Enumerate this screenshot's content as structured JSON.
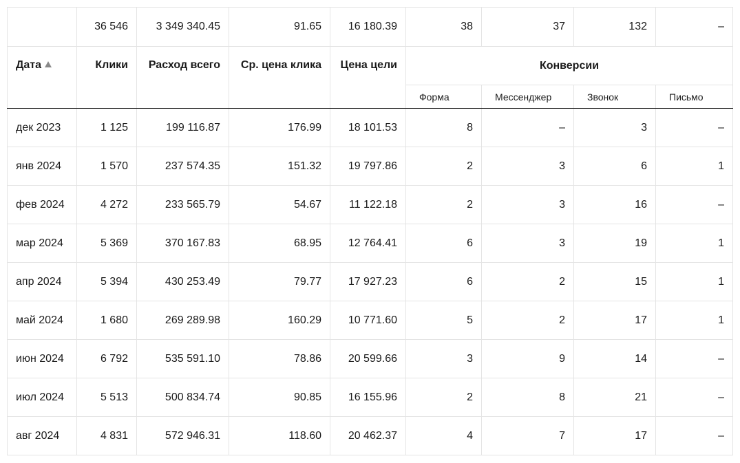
{
  "totals": [
    "",
    "36 546",
    "3 349 340.45",
    "91.65",
    "16 180.39",
    "38",
    "37",
    "132",
    "–"
  ],
  "headers": {
    "date": "Дата",
    "clicks": "Клики",
    "spend": "Расход всего",
    "cpc": "Ср. цена клика",
    "goal_price": "Цена цели",
    "conversions": "Конверсии",
    "conv_form": "Форма",
    "conv_messenger": "Мессенджер",
    "conv_call": "Звонок",
    "conv_email": "Письмо"
  },
  "sort": {
    "column": "date",
    "direction": "ascending",
    "icon": "sort-ascending-icon"
  },
  "rows": [
    [
      "дек 2023",
      "1 125",
      "199 116.87",
      "176.99",
      "18 101.53",
      "8",
      "–",
      "3",
      "–"
    ],
    [
      "янв 2024",
      "1 570",
      "237 574.35",
      "151.32",
      "19 797.86",
      "2",
      "3",
      "6",
      "1"
    ],
    [
      "фев 2024",
      "4 272",
      "233 565.79",
      "54.67",
      "11 122.18",
      "2",
      "3",
      "16",
      "–"
    ],
    [
      "мар 2024",
      "5 369",
      "370 167.83",
      "68.95",
      "12 764.41",
      "6",
      "3",
      "19",
      "1"
    ],
    [
      "апр 2024",
      "5 394",
      "430 253.49",
      "79.77",
      "17 927.23",
      "6",
      "2",
      "15",
      "1"
    ],
    [
      "май 2024",
      "1 680",
      "269 289.98",
      "160.29",
      "10 771.60",
      "5",
      "2",
      "17",
      "1"
    ],
    [
      "июн 2024",
      "6 792",
      "535 591.10",
      "78.86",
      "20 599.66",
      "3",
      "9",
      "14",
      "–"
    ],
    [
      "июл 2024",
      "5 513",
      "500 834.74",
      "90.85",
      "16 155.96",
      "2",
      "8",
      "21",
      "–"
    ],
    [
      "авг 2024",
      "4 831",
      "572 946.31",
      "118.60",
      "20 462.37",
      "4",
      "7",
      "17",
      "–"
    ]
  ]
}
